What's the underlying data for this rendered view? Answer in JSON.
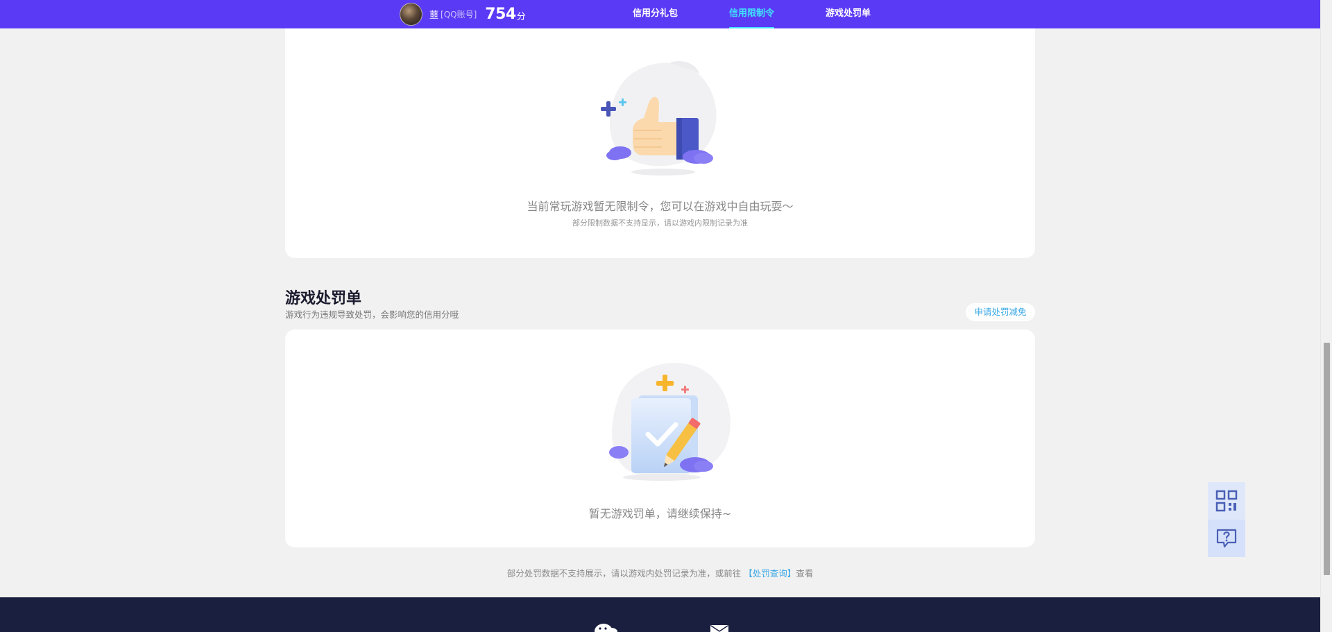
{
  "header": {
    "user_name": "蘁",
    "account_type": "[QQ账号]",
    "score": "754",
    "score_unit": "分",
    "nav": [
      {
        "label": "信用分礼包",
        "active": false
      },
      {
        "label": "信用限制令",
        "active": true
      },
      {
        "label": "游戏处罚单",
        "active": false
      }
    ]
  },
  "restrictions": {
    "empty_text": "当前常玩游戏暂无限制令，您可以在游戏中自由玩耍～",
    "note": "部分限制数据不支持显示，请以游戏内限制记录为准"
  },
  "penalty": {
    "title": "游戏处罚单",
    "subtitle": "游戏行为违规导致处罚，会影响您的信用分哦",
    "appeal_button": "申请处罚减免",
    "empty_text": "暂无游戏罚单，请继续保持~",
    "footnote_prefix": "部分处罚数据不支持展示，请以游戏内处罚记录为准，或前往",
    "footnote_link": "【处罚查询】",
    "footnote_suffix": "查看"
  },
  "side_tools": {
    "icons": [
      "qrcode-icon",
      "help-chat-icon"
    ]
  },
  "colors": {
    "nav_bg": "#5b3af5",
    "nav_active": "#41e0ff",
    "link": "#3aa8e6",
    "footer_bg": "#1b1f3f"
  }
}
